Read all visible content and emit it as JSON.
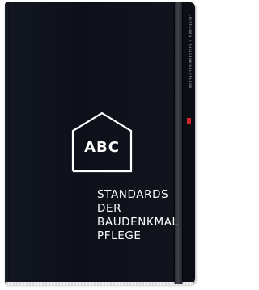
{
  "cover": {
    "monogram": "ABC",
    "title_lines": [
      "STANDARDS",
      "DER",
      "BAUDENKMAL",
      "PFLEGE"
    ],
    "series_label": "LEITFADEN | BAUDENKMALPFLEGE"
  },
  "colors": {
    "cover": "#0d1019",
    "band": "#3a3c42",
    "text": "#ffffff",
    "publisher_mark": "#d1262b"
  },
  "icons": {
    "house": "house-outline-icon"
  }
}
